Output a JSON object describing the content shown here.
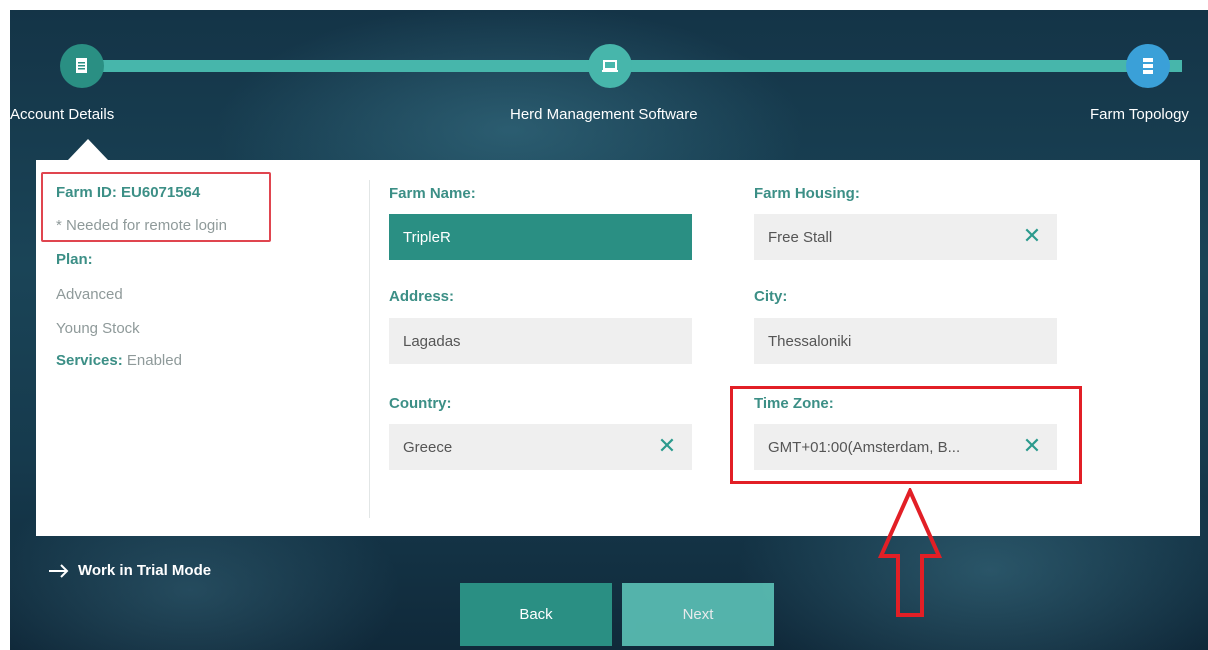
{
  "steps": [
    {
      "label": "Account Details",
      "icon": "document-icon",
      "color": "#2a8f83"
    },
    {
      "label": "Herd Management Software",
      "icon": "laptop-icon",
      "color": "#47b6ab"
    },
    {
      "label": "Farm Topology",
      "icon": "server-icon",
      "color": "#3aa0d8"
    }
  ],
  "summary": {
    "farm_id": "Farm ID: EU6071564",
    "remote_note": "* Needed for remote login",
    "plan_label": "Plan:",
    "plans": [
      "Advanced",
      "Young Stock"
    ],
    "services_label": "Services:",
    "services_value": "Enabled"
  },
  "form": {
    "farm_name": {
      "label": "Farm Name:",
      "value": "TripleR"
    },
    "farm_housing": {
      "label": "Farm Housing:",
      "value": "Free Stall"
    },
    "address": {
      "label": "Address:",
      "value": "Lagadas"
    },
    "city": {
      "label": "City:",
      "value": "Thessaloniki"
    },
    "country": {
      "label": "Country:",
      "value": "Greece"
    },
    "time_zone": {
      "label": "Time Zone:",
      "value": "GMT+01:00(Amsterdam, B..."
    }
  },
  "clear_glyph": "✕",
  "trial_mode": "Work in Trial Mode",
  "buttons": {
    "back": "Back",
    "next": "Next"
  },
  "colors": {
    "accent": "#2a8f83",
    "highlight": "#e21f26"
  }
}
